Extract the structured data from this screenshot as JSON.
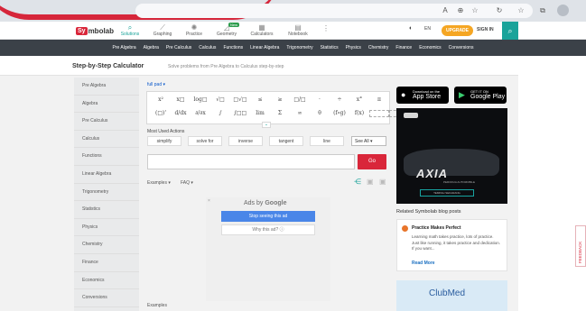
{
  "header": {
    "logo_badge": "Sy",
    "logo_rest": "mbolab",
    "nav": [
      {
        "label": "Solutions",
        "icon": "magnifier-icon",
        "glyph": "⌕"
      },
      {
        "label": "Graphing",
        "icon": "graph-icon",
        "glyph": "⟋"
      },
      {
        "label": "Practice",
        "icon": "lightbulb-icon",
        "glyph": "✺"
      },
      {
        "label": "Geometry",
        "icon": "geometry-icon",
        "glyph": "◿"
      },
      {
        "label": "Calculators",
        "icon": "calculator-icon",
        "glyph": "▦"
      },
      {
        "label": "Notebook",
        "icon": "notebook-icon",
        "glyph": "▤"
      }
    ],
    "new_badge": "New",
    "lang": "EN",
    "upgrade": "UPGRADE",
    "signin": "SIGN IN"
  },
  "topics": [
    "Pre Algebra",
    "Algebra",
    "Pre Calculus",
    "Calculus",
    "Functions",
    "Linear Algebra",
    "Trigonometry",
    "Statistics",
    "Physics",
    "Chemistry",
    "Finance",
    "Economics",
    "Conversions"
  ],
  "page": {
    "title": "Step-by-Step Calculator",
    "subtitle": "Solve problems from Pre Algebra to Calculus step-by-step"
  },
  "sidebar": [
    "Pre Algebra",
    "Algebra",
    "Pre Calculus",
    "Calculus",
    "Functions",
    "Linear Algebra",
    "Trigonometry",
    "Statistics",
    "Physics",
    "Chemistry",
    "Finance",
    "Economics",
    "Conversions"
  ],
  "keypad": {
    "full_pad": "full pad ▾",
    "row1": [
      "x²",
      "x□",
      "log□",
      "√□",
      "□√□",
      "≤",
      "≥",
      "□/□",
      "·",
      "÷",
      "x°",
      "π"
    ],
    "row2": [
      "(□)'",
      "d/dx",
      "∂/∂x",
      "∫",
      "∫□□",
      "lim",
      "Σ",
      "∞",
      "θ",
      "(f∘g)",
      "f(x)"
    ]
  },
  "most_used": {
    "label": "Most Used Actions",
    "actions": [
      "simplify",
      "solve for",
      "inverse",
      "tangent",
      "line"
    ],
    "see_all": "See All ▾"
  },
  "input": {
    "value": "",
    "go": "Go"
  },
  "links": {
    "examples": "Examples ▾",
    "faq": "FAQ ▾",
    "examples_bottom": "Examples"
  },
  "ad": {
    "ads_by": "Ads by",
    "google": "Google",
    "stop": "Stop seeing this ad",
    "why": "Why this ad? ⓘ",
    "close": "×"
  },
  "stores": [
    {
      "small": "Download on the",
      "large": "App Store",
      "icon": "apple-icon",
      "glyph": "●"
    },
    {
      "small": "GET IT ON",
      "large": "Google Play",
      "icon": "play-icon",
      "glyph": "▶"
    }
  ],
  "car_ad": {
    "brand": "AXIA",
    "sub": "PERODUA AUTOMOBILE",
    "cta": "TEMPAH SEKARANG"
  },
  "related": {
    "heading": "Related Symbolab blog posts",
    "post_title": "Practice Makes Perfect",
    "post_body": "Learning math takes practice, lots of practice. Just like running, it takes practice and dedication. If you want...",
    "read_more": "Read More"
  },
  "clubmed": "ClubMed",
  "feedback": "FEEDBACK"
}
